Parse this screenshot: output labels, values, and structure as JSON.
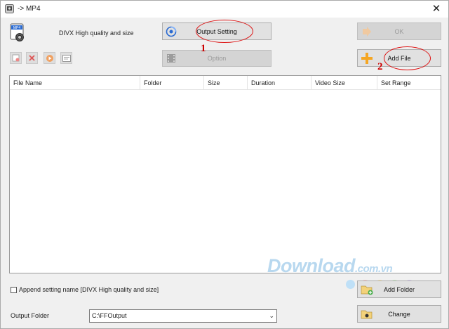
{
  "window": {
    "title": "-> MP4",
    "close_glyph": "✕",
    "icon": "app-icon"
  },
  "profile": {
    "format_icon_label": "MP4",
    "name": "DIVX High quality and size"
  },
  "buttons": {
    "output_setting": "Output Setting",
    "option": "Option",
    "ok": "OK",
    "add_file": "Add File",
    "add_folder": "Add Folder",
    "change": "Change"
  },
  "toolbar": {
    "icons": [
      "remove-icon",
      "clear-icon",
      "play-icon",
      "media-info-icon"
    ]
  },
  "annotations": {
    "callout_1": "1",
    "callout_2": "2"
  },
  "file_list": {
    "columns": [
      "File Name",
      "Folder",
      "Size",
      "Duration",
      "Video Size",
      "Set Range"
    ],
    "rows": []
  },
  "watermark": {
    "main": "Download",
    "suffix": ".com.vn",
    "dot_colors": [
      "#bfe0f7",
      "#f7c8c8",
      "#f9e3a8",
      "#c9ecc3",
      "#d6c8f0"
    ]
  },
  "append": {
    "checked": false,
    "label": "Append setting name [DIVX High quality and size]"
  },
  "output_folder": {
    "label": "Output Folder",
    "value": "C:\\FFOutput",
    "arrow": "⌄"
  },
  "colors": {
    "accent_red": "#d11111",
    "add_orange": "#f5a623"
  }
}
